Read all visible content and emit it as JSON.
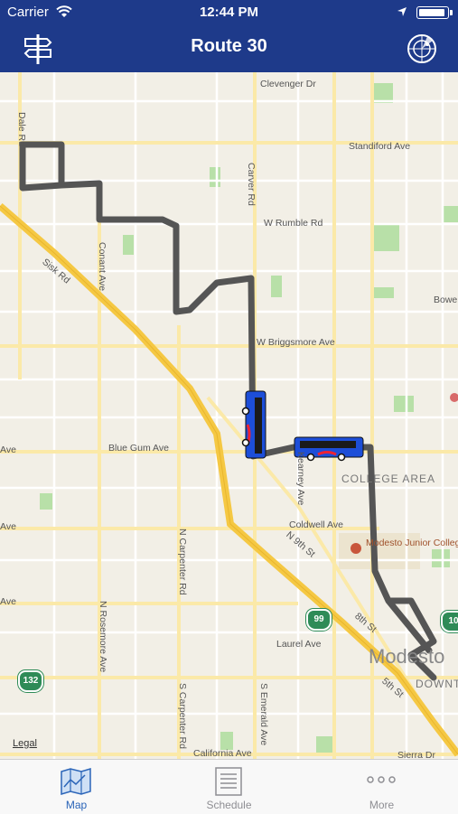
{
  "status_bar": {
    "carrier": "Carrier",
    "time": "12:44 PM",
    "battery_level": 0.95
  },
  "nav": {
    "title": "Route 30",
    "left_icon": "signpost-icon",
    "right_icon": "radar-icon"
  },
  "map": {
    "streets": {
      "clevenger": "Clevenger Dr",
      "dale": "Dale Rd",
      "standiford": "Standiford Ave",
      "carver": "Carver Rd",
      "rumble": "W Rumble Rd",
      "conant": "Conant Ave",
      "sisk": "Sisk Rd",
      "bowen": "Bowe",
      "briggsmore": "W Briggsmore Ave",
      "blue_gum": "Blue Gum Ave",
      "kearney": "Kearney Ave",
      "ave_left_1": "Ave",
      "ave_left_2": "Ave",
      "ave_left_3": "Ave",
      "coldwell": "Coldwell Ave",
      "n9th": "N 9th St",
      "n_carpenter": "N Carpenter Rd",
      "n_rosemore": "N Rosemore Ave",
      "st8th": "8th St",
      "laurel": "Laurel Ave",
      "st5th": "5th St",
      "s_carpenter": "S Carpenter Rd",
      "s_emerald": "S Emerald Ave",
      "california": "California Ave",
      "sierra": "Sierra Dr"
    },
    "areas": {
      "college_area": "COLLEGE AREA",
      "mjc": "Modesto Junior College",
      "modesto": "Modesto",
      "downtown": "DOWNT"
    },
    "shields": {
      "hwy99": "99",
      "hwy132": "132",
      "hwy108": "10"
    },
    "legal": "Legal",
    "route_color": "#555555",
    "bus_color": "#1d4ed8",
    "freeway_color": "#f5c843"
  },
  "tabs": [
    {
      "label": "Map",
      "icon": "map-icon",
      "active": true
    },
    {
      "label": "Schedule",
      "icon": "schedule-icon",
      "active": false
    },
    {
      "label": "More",
      "icon": "more-icon",
      "active": false
    }
  ]
}
